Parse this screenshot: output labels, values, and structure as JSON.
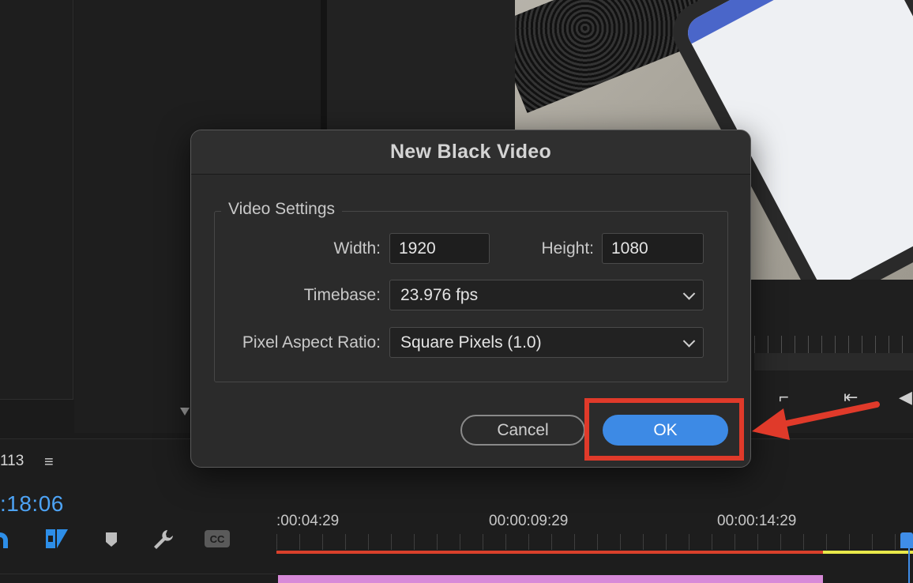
{
  "dialog": {
    "title": "New Black Video",
    "group_label": "Video Settings",
    "width_label": "Width:",
    "width_value": "1920",
    "height_label": "Height:",
    "height_value": "1080",
    "timebase_label": "Timebase:",
    "timebase_value": "23.976 fps",
    "par_label": "Pixel Aspect Ratio:",
    "par_value": "Square Pixels (1.0)",
    "cancel_label": "Cancel",
    "ok_label": "OK"
  },
  "timeline": {
    "sequence_number": "113",
    "menu_icon": "≡",
    "timecode": ":18:06",
    "ruler_labels": [
      ":00:04:29",
      "00:00:09:29",
      "00:00:14:29"
    ]
  },
  "tools": {
    "magnet_icon": "snap-icon",
    "linked_icon": "linked-selection-icon",
    "marker_icon": "add-marker-icon",
    "wrench_icon": "wrench-icon",
    "cc_label": "CC"
  },
  "colors": {
    "accent_blue": "#3d8ae5",
    "timecode_blue": "#4da3f5",
    "annotation_red": "#e03a2a",
    "clip_pink": "#d88ad8",
    "work_area_red": "#d9402b",
    "work_area_yellow": "#e8e84a"
  }
}
